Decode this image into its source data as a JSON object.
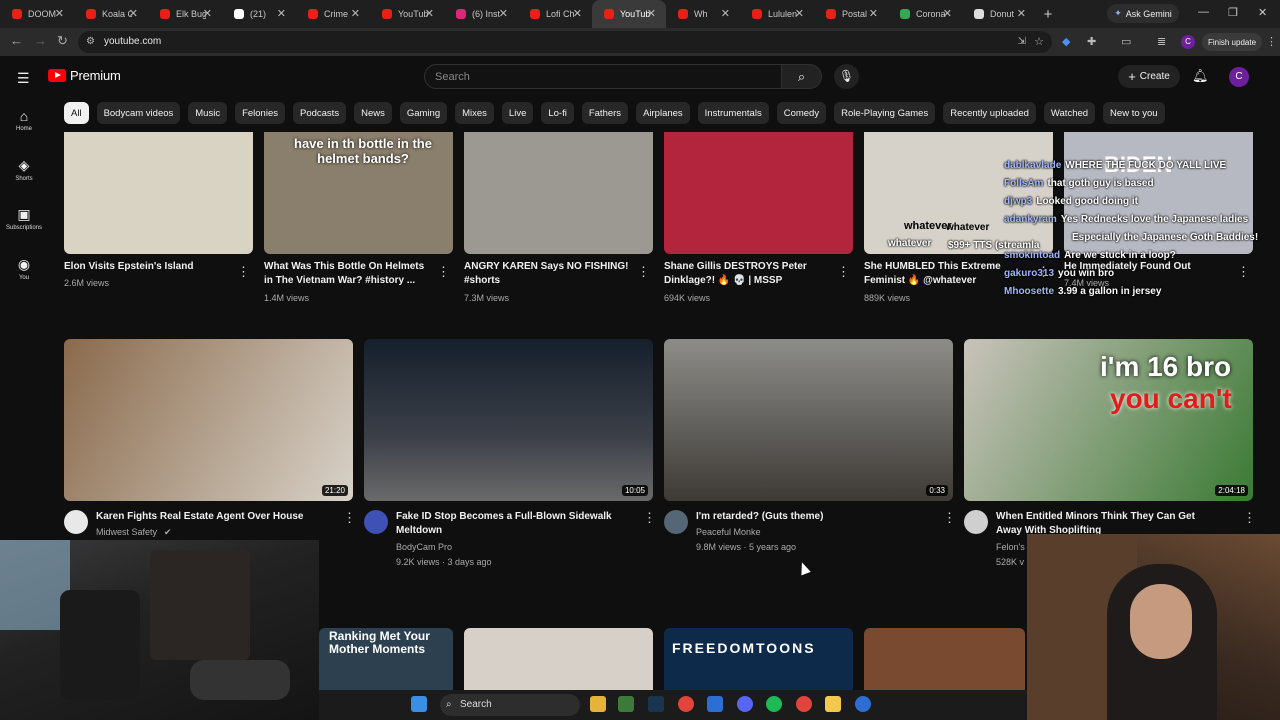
{
  "browser": {
    "tabs": [
      {
        "label": "DOOM",
        "color": "#e62117"
      },
      {
        "label": "Koala G",
        "color": "#e62117"
      },
      {
        "label": "Elk Bug",
        "color": "#e62117"
      },
      {
        "label": "(21)",
        "color": "#ffffff"
      },
      {
        "label": "Crime",
        "color": "#e62117"
      },
      {
        "label": "YouTub",
        "color": "#e62117"
      },
      {
        "label": "(6) Inst",
        "color": "#d62976"
      },
      {
        "label": "Lofi Ch",
        "color": "#e62117"
      },
      {
        "label": "YouTub",
        "color": "#e62117",
        "active": true
      },
      {
        "label": "Wh",
        "color": "#e62117"
      },
      {
        "label": "Lululen",
        "color": "#e62117"
      },
      {
        "label": "Postal",
        "color": "#e62117"
      },
      {
        "label": "Corona",
        "color": "#34a853"
      },
      {
        "label": "Donut",
        "color": "#dddddd"
      }
    ],
    "ask_gemini": "Ask Gemini",
    "url": "youtube.com",
    "finish_update": "Finish update",
    "profile_initial": "C"
  },
  "youtube": {
    "brand": "Premium",
    "search_placeholder": "Search",
    "create_label": "Create",
    "avatar_initial": "C",
    "rail": [
      {
        "icon": "home-icon",
        "glyph": "⌂",
        "label": "Home"
      },
      {
        "icon": "shorts-icon",
        "glyph": "◈",
        "label": "Shorts"
      },
      {
        "icon": "subscriptions-icon",
        "glyph": "▣",
        "label": "Subscriptions"
      },
      {
        "icon": "you-icon",
        "glyph": "◉",
        "label": "You"
      }
    ],
    "chips": [
      "All",
      "Bodycam videos",
      "Music",
      "Felonies",
      "Podcasts",
      "News",
      "Gaming",
      "Mixes",
      "Live",
      "Lo-fi",
      "Fathers",
      "Airplanes",
      "Instrumentals",
      "Comedy",
      "Role-Playing Games",
      "Recently uploaded",
      "Watched",
      "New to you"
    ],
    "shorts_row": [
      {
        "title": "Elon Visits Epstein's Island",
        "views": "2.6M views",
        "thumb_text": ""
      },
      {
        "title": "What Was This Bottle On Helmets in The Vietnam War? #history ...",
        "views": "1.4M views",
        "thumb_text": "have in th bottle in the helmet bands?"
      },
      {
        "title": "ANGRY KAREN Says NO FISHING! #shorts",
        "views": "7.3M views",
        "thumb_text": ""
      },
      {
        "title": "Shane Gillis DESTROYS Peter Dinklage?! 🔥 💀 | MSSP",
        "views": "694K views",
        "thumb_text": ""
      },
      {
        "title": "She HUMBLED This Extreme Feminist 🔥 @whatever",
        "views": "889K views",
        "thumb_text": "whatever"
      },
      {
        "title": "He Immediately Found Out",
        "views": "7.4M views",
        "thumb_text": "BIDEN"
      }
    ],
    "videos": [
      {
        "title": "Karen Fights Real Estate Agent Over House",
        "channel": "Midwest Safety",
        "verified": "✔",
        "stats": "",
        "duration": "21:20"
      },
      {
        "title": "Fake ID Stop Becomes a Full-Blown Sidewalk Meltdown",
        "channel": "BodyCam Pro",
        "stats": "9.2K views · 3 days ago",
        "duration": "10:05"
      },
      {
        "title": "I'm retarded? (Guts theme)",
        "channel": "Peaceful Monke",
        "stats": "9.8M views · 5 years ago",
        "duration": "0:33"
      },
      {
        "title": "When Entitled Minors Think They Can Get Away With Shoplifting",
        "channel": "Felon's",
        "stats": "528K v",
        "duration": "2:04:18",
        "thumb_line1": "i'm 16 bro",
        "thumb_line2": "you can't"
      }
    ],
    "bottom_row": [
      {
        "thumb_text": "Ranking Met Your Mother Moments"
      },
      {
        "thumb_text": ""
      },
      {
        "thumb_text": "FREEDOMTOONS"
      },
      {
        "thumb_text": ""
      }
    ]
  },
  "stream_overlay": {
    "tts_text": "$99+ TTS (streamla",
    "tts_user": "whatever",
    "tts_user2": "whatever",
    "chat": [
      {
        "user": "dablkavlade",
        "msg": "WHERE THE FUCK DO YALL LIVE"
      },
      {
        "user": "FollsAm",
        "msg": "that goth guy is based"
      },
      {
        "user": "djwp3",
        "msg": "Looked good doing it"
      },
      {
        "user": "adankyram",
        "msg": "Yes Rednecks love the Japanese ladies"
      },
      {
        "user": "",
        "msg": "Especially the Japanese Goth Baddies!"
      },
      {
        "user": "smokintoad",
        "msg": "Are we stuck in a loop?"
      },
      {
        "user": "gakuro313",
        "msg": "you win bro"
      },
      {
        "user": "Mhoosette",
        "msg": "3.99 a gallon in jersey"
      }
    ]
  },
  "taskbar": {
    "search_label": "Search"
  }
}
